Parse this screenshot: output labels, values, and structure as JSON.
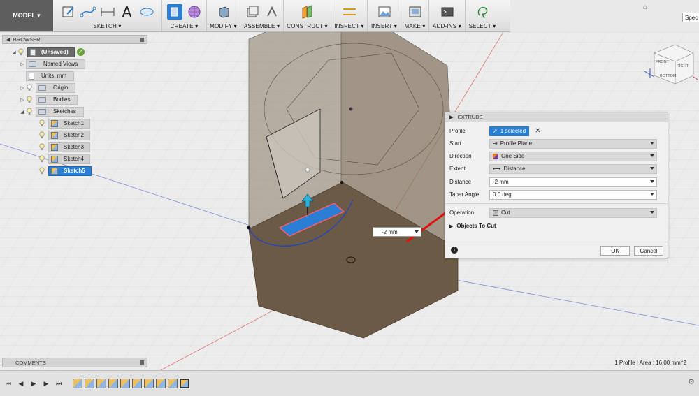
{
  "toolbar": {
    "model_label": "MODEL ▾",
    "groups": [
      {
        "label": "SKETCH ▾"
      },
      {
        "label": "CREATE ▾"
      },
      {
        "label": "MODIFY ▾"
      },
      {
        "label": "ASSEMBLE ▾"
      },
      {
        "label": "CONSTRUCT ▾"
      },
      {
        "label": "INSPECT ▾"
      },
      {
        "label": "INSERT ▾"
      },
      {
        "label": "MAKE ▾"
      },
      {
        "label": "ADD-INS ▾"
      },
      {
        "label": "SELECT ▾"
      }
    ],
    "text_tool_glyph": "A"
  },
  "browser": {
    "title": "BROWSER",
    "root": "(Unsaved)",
    "items": [
      {
        "label": "Named Views"
      },
      {
        "label": "Units: mm"
      },
      {
        "label": "Origin"
      },
      {
        "label": "Bodies"
      },
      {
        "label": "Sketches"
      }
    ],
    "sketches": [
      {
        "label": "Sketch1"
      },
      {
        "label": "Sketch2"
      },
      {
        "label": "Sketch3"
      },
      {
        "label": "Sketch4"
      },
      {
        "label": "Sketch5"
      }
    ]
  },
  "extrude": {
    "title": "EXTRUDE",
    "rows": {
      "profile": {
        "label": "Profile",
        "value": "1 selected"
      },
      "start": {
        "label": "Start",
        "value": "Profile Plane"
      },
      "direction": {
        "label": "Direction",
        "value": "One Side"
      },
      "extent": {
        "label": "Extent",
        "value": "Distance"
      },
      "distance": {
        "label": "Distance",
        "value": "-2 mm"
      },
      "taper": {
        "label": "Taper Angle",
        "value": "0.0 deg"
      },
      "operation": {
        "label": "Operation",
        "value": "Cut"
      }
    },
    "objects_to_cut": "Objects To Cut",
    "ok": "OK",
    "cancel": "Cancel"
  },
  "viewport": {
    "dim_input": "-2 mm",
    "viewcube_label": "Spec",
    "cube_faces": {
      "front": "FRONT",
      "right": "RIGHT",
      "bottom": "BOTTOM"
    }
  },
  "comments_label": "COMMENTS",
  "status": "1 Profile | Area : 16.00 mm^2",
  "colors": {
    "accent": "#2a7fd4",
    "body": "#6b5a45",
    "arrow": "#e01010"
  }
}
